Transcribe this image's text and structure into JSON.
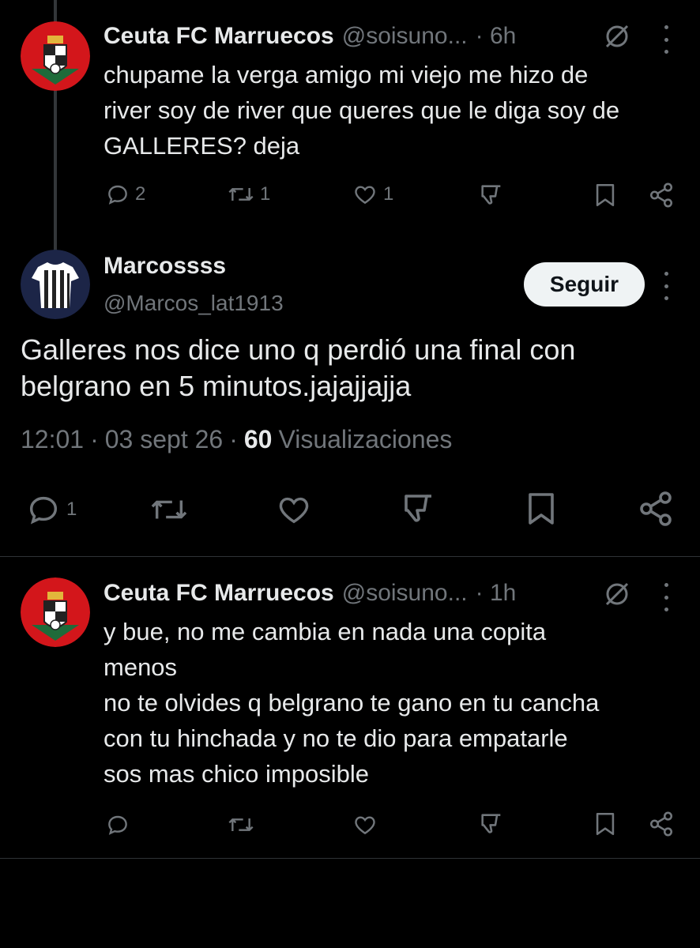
{
  "tweet1": {
    "name": "Ceuta FC Marruecos",
    "handle": "@soisuno...",
    "time": "· 6h",
    "text": "chupame la verga amigo mi viejo me hizo de\nriver soy de river que queres que le diga soy de\nGALLERES? deja",
    "reply_count": "2",
    "retweet_count": "1",
    "like_count": "1"
  },
  "main_tweet": {
    "name": "Marcossss",
    "handle": "@Marcos_lat1913",
    "follow_label": "Seguir",
    "text": "Galleres nos dice uno q perdió una final con\nbelgrano en 5 minutos.jajajjajja",
    "time": "12:01",
    "dot1": "·",
    "date": "03 sept 26",
    "dot2": "·",
    "views_count": "60",
    "views_label": "Visualizaciones",
    "reply_count": "1"
  },
  "tweet3": {
    "name": "Ceuta FC Marruecos",
    "handle": "@soisuno...",
    "time": "· 1h",
    "text": "y bue, no me cambia en nada una copita\nmenos\nno te olvides q belgrano te gano en tu cancha\ncon tu hinchada y no te dio para empatarle\nsos mas chico imposible"
  },
  "colors": {
    "background": "#000000",
    "text": "#e7e9ea",
    "secondary": "#71767b",
    "divider": "#2f3336",
    "button_bg": "#eff3f4"
  },
  "icons": [
    "reply-icon",
    "retweet-icon",
    "like-icon",
    "dislike-icon",
    "bookmark-icon",
    "share-icon",
    "grok-icon",
    "more-icon"
  ]
}
